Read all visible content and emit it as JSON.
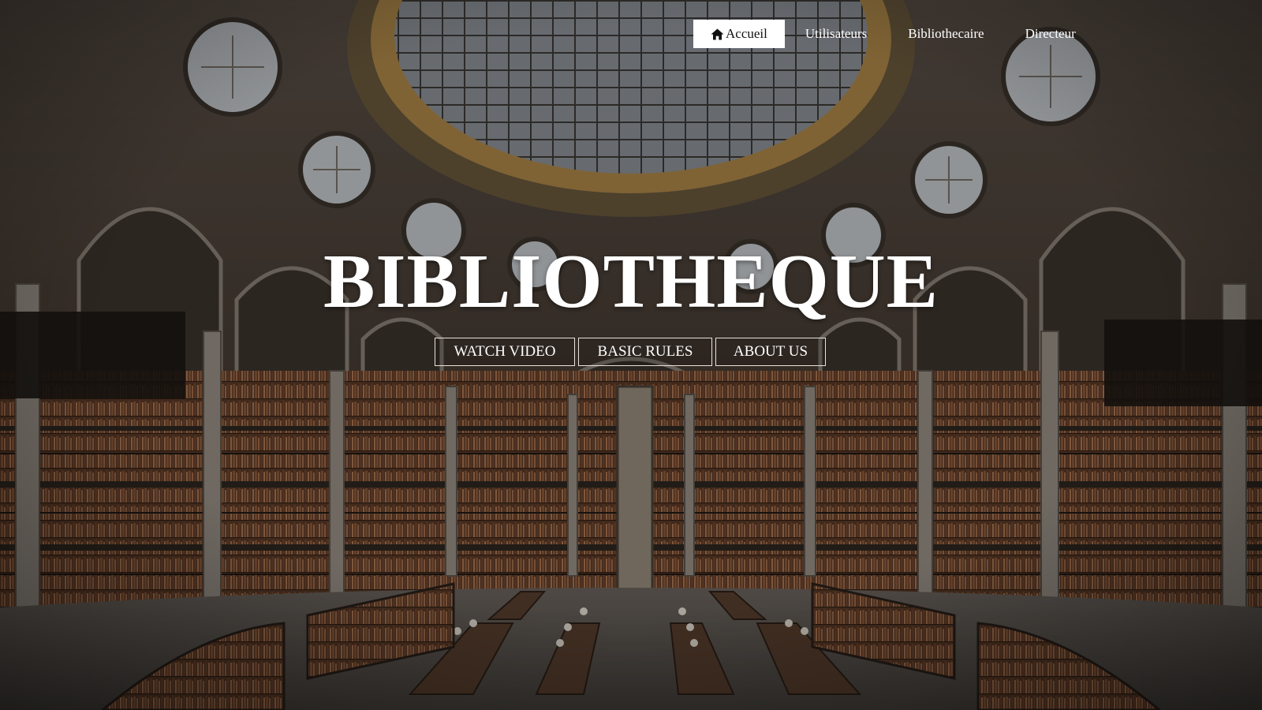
{
  "nav": {
    "items": [
      {
        "label": "Accueil",
        "icon": "home-icon",
        "active": true
      },
      {
        "label": "Utilisateurs"
      },
      {
        "label": "Bibliothecaire"
      },
      {
        "label": "Directeur"
      }
    ]
  },
  "hero": {
    "title": "BIBLIOTHEQUE",
    "buttons": {
      "watch_video": "WATCH VIDEO",
      "basic_rules": "BASIC RULES",
      "about_us": "ABOUT US"
    }
  },
  "colors": {
    "overlay": "#000000",
    "text": "#ffffff",
    "active_nav_bg": "#ffffff",
    "wood": "#6b4a32",
    "stone": "#8c8479"
  }
}
